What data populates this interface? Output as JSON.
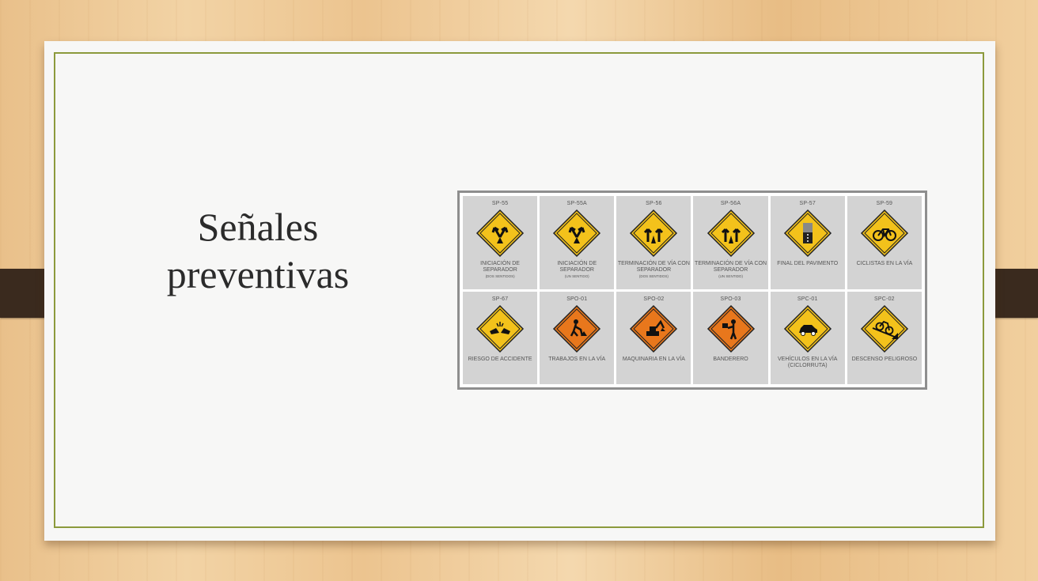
{
  "slide": {
    "title_line1": "Señales",
    "title_line2": "preventivas"
  },
  "signs": [
    {
      "code": "SP-55",
      "label": "INICIACIÓN DE SEPARADOR",
      "sub": "(DOS SENTIDOS)",
      "color": "#f3c21b",
      "icon": "split-arrows-icon"
    },
    {
      "code": "SP-55A",
      "label": "INICIACIÓN DE SEPARADOR",
      "sub": "(UN SENTIDO)",
      "color": "#f3c21b",
      "icon": "split-arrows-icon"
    },
    {
      "code": "SP-56",
      "label": "TERMINACIÓN DE VÍA CON SEPARADOR",
      "sub": "(DOS SENTIDOS)",
      "color": "#f3c21b",
      "icon": "merge-arrows-icon"
    },
    {
      "code": "SP-56A",
      "label": "TERMINACIÓN DE VÍA CON SEPARADOR",
      "sub": "(UN SENTIDO)",
      "color": "#f3c21b",
      "icon": "merge-arrows-icon"
    },
    {
      "code": "SP-57",
      "label": "FINAL DEL PAVIMENTO",
      "sub": "",
      "color": "#f3c21b",
      "icon": "pavement-end-icon"
    },
    {
      "code": "SP-59",
      "label": "CICLISTAS EN LA VÍA",
      "sub": "",
      "color": "#f3c21b",
      "icon": "bicycle-icon"
    },
    {
      "code": "SP-67",
      "label": "RIESGO DE ACCIDENTE",
      "sub": "",
      "color": "#f3c21b",
      "icon": "car-crash-icon"
    },
    {
      "code": "SPO-01",
      "label": "TRABAJOS EN LA VÍA",
      "sub": "",
      "color": "#e8771c",
      "icon": "roadwork-icon"
    },
    {
      "code": "SPO-02",
      "label": "MAQUINARIA EN LA VÍA",
      "sub": "",
      "color": "#e8771c",
      "icon": "excavator-icon"
    },
    {
      "code": "SPO-03",
      "label": "BANDERERO",
      "sub": "",
      "color": "#e8771c",
      "icon": "flagger-icon"
    },
    {
      "code": "SPC-01",
      "label": "VEHÍCULOS EN LA VÍA (CICLORRUTA)",
      "sub": "",
      "color": "#f3c21b",
      "icon": "car-icon"
    },
    {
      "code": "SPC-02",
      "label": "DESCENSO PELIGROSO",
      "sub": "",
      "color": "#f3c21b",
      "icon": "bicycle-downhill-icon"
    }
  ]
}
